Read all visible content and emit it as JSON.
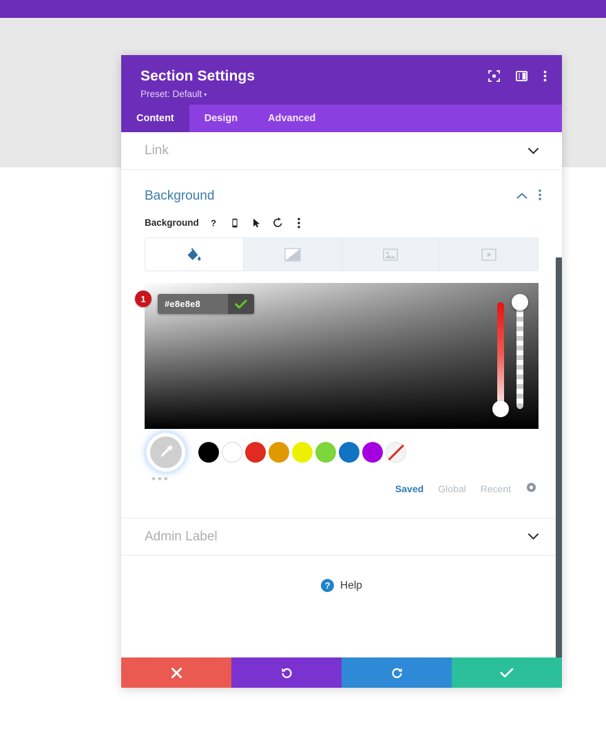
{
  "page": {
    "backdrop_bar_color": "#6c2eb9",
    "backdrop_band_color": "#e8e8e8",
    "page_background": "#ffffff"
  },
  "modal": {
    "title": "Section Settings",
    "preset_label": "Preset: Default",
    "preset_caret": "▾",
    "header_icons": [
      {
        "name": "focus-icon",
        "label": "focus"
      },
      {
        "name": "layout-panel-icon",
        "label": "layout"
      },
      {
        "name": "more-vertical-icon",
        "label": "more"
      }
    ],
    "tabs": [
      {
        "label": "Content",
        "active": true
      },
      {
        "label": "Design",
        "active": false
      },
      {
        "label": "Advanced",
        "active": false
      }
    ],
    "accent_color": "#6c2eb9",
    "tabs_bar_color": "#8c3fe0"
  },
  "body": {
    "link_toggle": {
      "label": "Link",
      "chevron": "⌄"
    },
    "background_section": {
      "title": "Background",
      "collapse_chevron": "⌃",
      "more_icon": "more-vertical-icon",
      "field_label": "Background",
      "field_icons": [
        {
          "name": "help-question-icon",
          "glyph": "?"
        },
        {
          "name": "mobile-device-icon",
          "glyph": ""
        },
        {
          "name": "hover-cursor-icon",
          "glyph": ""
        },
        {
          "name": "reset-undo-icon",
          "glyph": ""
        },
        {
          "name": "more-vertical-icon",
          "glyph": ""
        }
      ],
      "bg_types": [
        {
          "name": "bg-color-tab",
          "icon": "paint-bucket-icon",
          "active": true
        },
        {
          "name": "bg-gradient-tab",
          "icon": "gradient-icon",
          "active": false
        },
        {
          "name": "bg-image-tab",
          "icon": "image-icon",
          "active": false
        },
        {
          "name": "bg-video-tab",
          "icon": "video-icon",
          "active": false
        }
      ],
      "color_picker": {
        "hex_value": "#e8e8e8",
        "hex_placeholder": "#ffffff",
        "confirm_icon": "check-icon",
        "badge_number": "1",
        "badge_color": "#c9151b",
        "hue_handle_position": "bottom",
        "alpha_handle_position": "top"
      },
      "eyedropper": {
        "name": "eyedropper-icon",
        "selected": true
      },
      "swatches": [
        {
          "name": "swatch-black",
          "color": "#000000"
        },
        {
          "name": "swatch-white",
          "color": "#ffffff"
        },
        {
          "name": "swatch-red",
          "color": "#e02b20"
        },
        {
          "name": "swatch-orange",
          "color": "#e09900"
        },
        {
          "name": "swatch-yellow",
          "color": "#edf000"
        },
        {
          "name": "swatch-green",
          "color": "#7cd63c"
        },
        {
          "name": "swatch-blue",
          "color": "#1173c2"
        },
        {
          "name": "swatch-purple",
          "color": "#a600e0"
        },
        {
          "name": "swatch-transparent",
          "color": "transparent"
        }
      ],
      "overflow_dots": "•••",
      "palette_tabs": [
        {
          "label": "Saved",
          "active": true
        },
        {
          "label": "Global",
          "active": false
        },
        {
          "label": "Recent",
          "active": false
        }
      ],
      "palette_settings_icon": "gear-icon"
    },
    "admin_label_toggle": {
      "label": "Admin Label",
      "chevron": "⌄"
    },
    "help": {
      "label": "Help",
      "icon_glyph": "?",
      "icon_color": "#2084c8"
    }
  },
  "footer": {
    "buttons": [
      {
        "name": "cancel-button",
        "icon": "close-x-icon",
        "color": "#ea5a51"
      },
      {
        "name": "undo-button",
        "icon": "undo-icon",
        "color": "#7a32d1"
      },
      {
        "name": "redo-button",
        "icon": "redo-icon",
        "color": "#2e8ad6"
      },
      {
        "name": "save-button",
        "icon": "check-icon",
        "color": "#2bbf9a"
      }
    ]
  },
  "scrollbar": {
    "name": "modal-scrollbar",
    "color": "#4f5a63"
  }
}
